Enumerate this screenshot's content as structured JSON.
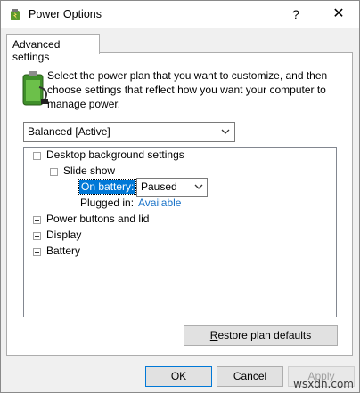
{
  "window": {
    "title": "Power Options",
    "help_label": "?",
    "close_label": "✕"
  },
  "tabs": [
    {
      "label": "Advanced settings"
    }
  ],
  "description": "Select the power plan that you want to customize, and then choose settings that reflect how you want your computer to manage power.",
  "plan": {
    "selected": "Balanced [Active]"
  },
  "tree": {
    "desktop_background": "Desktop background settings",
    "slide_show": "Slide show",
    "on_battery_label": "On battery:",
    "on_battery_value": "Paused",
    "plugged_in_label": "Plugged in:",
    "plugged_in_value": "Available",
    "power_buttons": "Power buttons and lid",
    "display": "Display",
    "battery": "Battery"
  },
  "buttons": {
    "restore_mnemonic": "R",
    "restore_rest": "estore plan defaults",
    "ok": "OK",
    "cancel": "Cancel",
    "apply_mnemonic": "A",
    "apply_rest": "pply"
  },
  "watermark": "wsxdn.com",
  "icons": {
    "title": "power-options-icon",
    "battery": "battery-plug-icon",
    "chevron": "chevron-down-icon"
  },
  "colors": {
    "selection": "#0078d7",
    "link": "#1a73c8",
    "window_bg": "#f0f0f0"
  }
}
